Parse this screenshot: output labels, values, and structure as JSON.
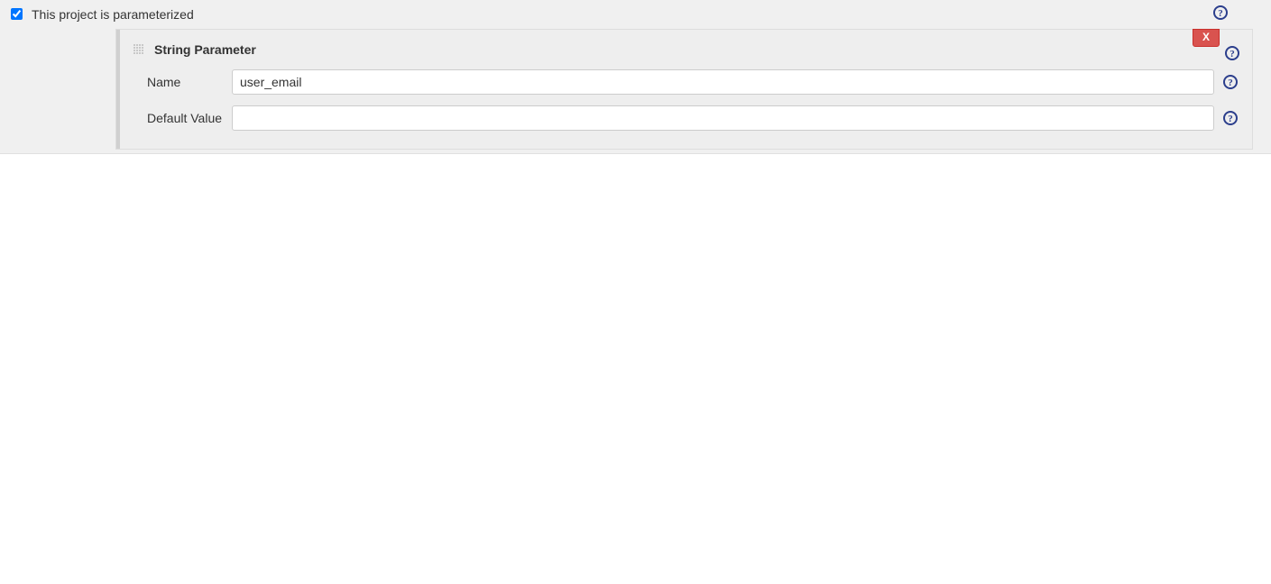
{
  "top": {
    "parameterized_label": "This project is parameterized",
    "parameterized_checked": true
  },
  "parameter": {
    "type_label": "String Parameter",
    "delete_label": "X",
    "fields": {
      "name": {
        "label": "Name",
        "value": "user_email"
      },
      "default_value": {
        "label": "Default Value",
        "value": ""
      }
    }
  }
}
